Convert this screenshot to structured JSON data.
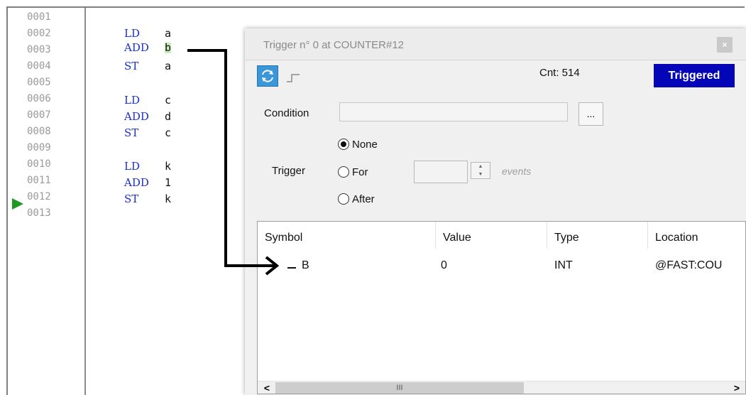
{
  "editor": {
    "line_numbers": [
      "0001",
      "0002",
      "0003",
      "0004",
      "0005",
      "0006",
      "0007",
      "0008",
      "0009",
      "0010",
      "0011",
      "0012",
      "0013"
    ],
    "code": [
      {
        "op": "LD",
        "arg": "a"
      },
      {
        "op": "ADD",
        "arg": "b"
      },
      {
        "op": "ST",
        "arg": "a"
      },
      {
        "op": "LD",
        "arg": "c"
      },
      {
        "op": "ADD",
        "arg": "d"
      },
      {
        "op": "ST",
        "arg": "c"
      },
      {
        "op": "LD",
        "arg": "k"
      },
      {
        "op": "ADD",
        "arg": "1"
      },
      {
        "op": "ST",
        "arg": "k"
      }
    ],
    "current_line": "0012",
    "highlighted_operand": "b"
  },
  "dialog": {
    "title": "Trigger n° 0 at COUNTER#12",
    "close_label": "×",
    "count_label": "Cnt: 514",
    "status_badge": "Triggered",
    "condition_label": "Condition",
    "condition_value": "",
    "browse_label": "...",
    "trigger_label": "Trigger",
    "trigger_options": [
      "None",
      "For",
      "After"
    ],
    "selected_option": "None",
    "events_label": "events",
    "event_count": "",
    "columns": [
      "Symbol",
      "Value",
      "Type",
      "Location"
    ],
    "rows": [
      {
        "symbol": "B",
        "value": "0",
        "type": "INT",
        "location": "@FAST:COU"
      }
    ],
    "scroll_grip": "III",
    "scroll_left": "<",
    "scroll_right": ">"
  },
  "colors": {
    "keyword": "#1a30d0",
    "highlight": "#c7efb8",
    "pc_arrow": "#1f9a1f",
    "badge_bg": "#0505b8",
    "mode_button": "#3c97d8"
  },
  "icons": {
    "current_line": "play-triangle-icon",
    "mode": "refresh-icon",
    "edge": "rising-edge-icon",
    "close": "close-icon"
  }
}
